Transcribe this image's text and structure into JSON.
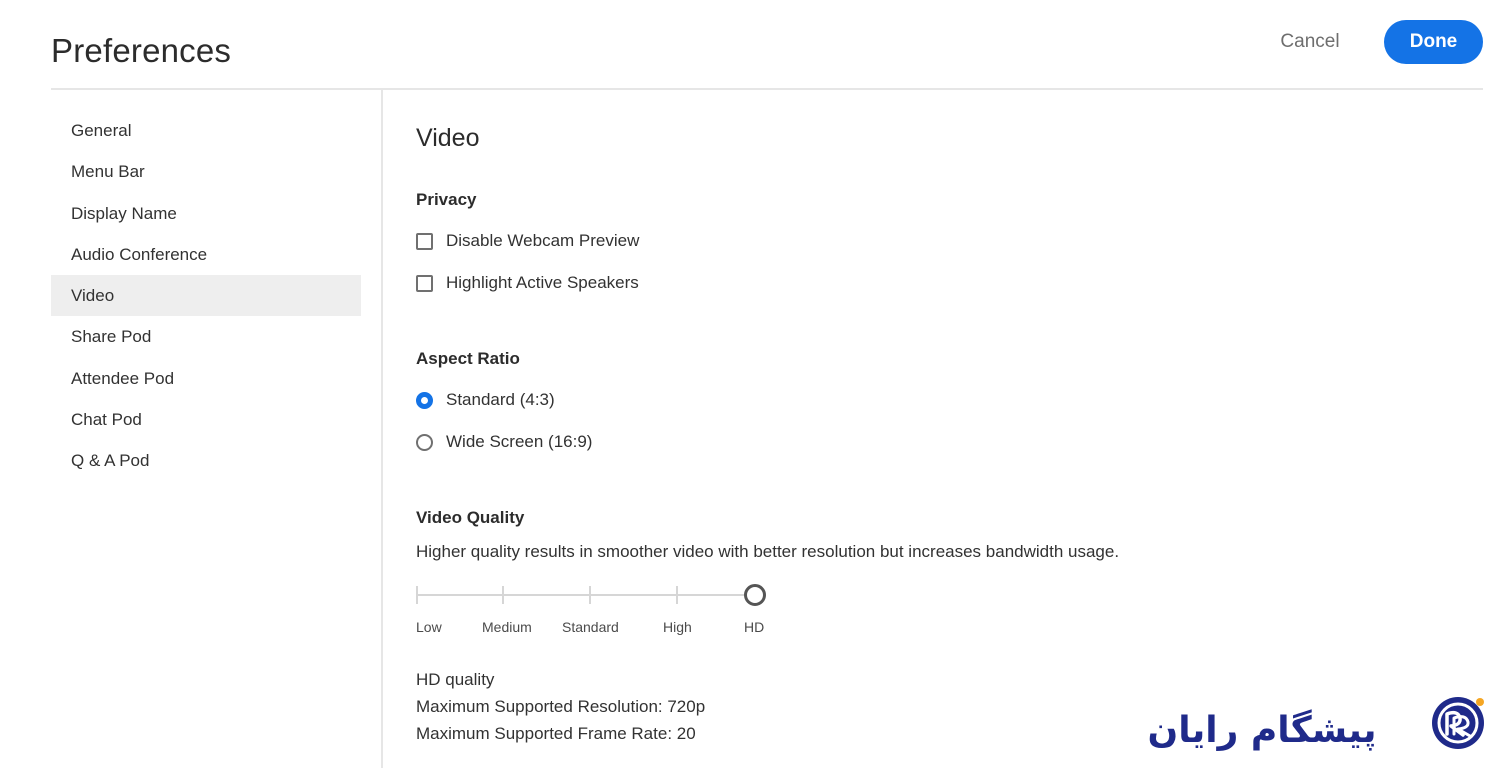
{
  "header": {
    "title": "Preferences",
    "cancel_label": "Cancel",
    "done_label": "Done"
  },
  "sidebar": {
    "items": [
      {
        "label": "General"
      },
      {
        "label": "Menu Bar"
      },
      {
        "label": "Display Name"
      },
      {
        "label": "Audio Conference"
      },
      {
        "label": "Video",
        "active": true
      },
      {
        "label": "Share Pod"
      },
      {
        "label": "Attendee Pod"
      },
      {
        "label": "Chat Pod"
      },
      {
        "label": "Q & A Pod"
      }
    ]
  },
  "video": {
    "title": "Video",
    "privacy": {
      "label": "Privacy",
      "options": [
        {
          "label": "Disable Webcam Preview",
          "checked": false
        },
        {
          "label": "Highlight Active Speakers",
          "checked": false
        }
      ]
    },
    "aspect_ratio": {
      "label": "Aspect Ratio",
      "options": [
        {
          "label": "Standard (4:3)",
          "selected": true
        },
        {
          "label": "Wide Screen (16:9)",
          "selected": false
        }
      ]
    },
    "quality": {
      "label": "Video Quality",
      "description": "Higher quality results in smoother video with better resolution but increases bandwidth usage.",
      "levels": [
        "Low",
        "Medium",
        "Standard",
        "High",
        "HD"
      ],
      "selected_level": "HD",
      "info": {
        "name": "HD quality",
        "resolution": "Maximum Supported Resolution: 720p",
        "frame_rate": "Maximum Supported Frame Rate: 20"
      }
    }
  },
  "watermark": {
    "text": "پیشگام رایان"
  },
  "colors": {
    "accent": "#1473e6",
    "logo": "#1f2a8a"
  }
}
